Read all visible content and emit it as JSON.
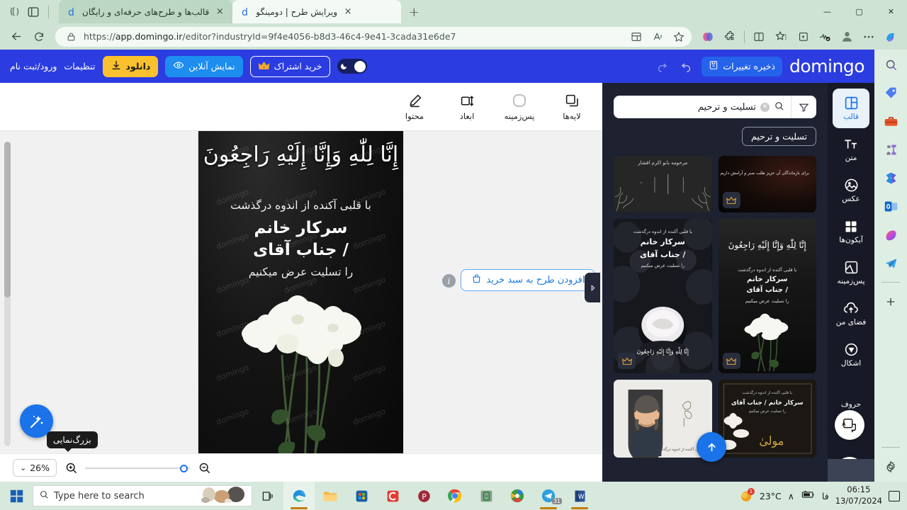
{
  "browser": {
    "tabs": [
      {
        "title": "قالب‌ها و طرح‌های حرفه‌ای و رایگان",
        "favicon": "domingo-d-icon",
        "active": false,
        "close": "×"
      },
      {
        "title": "ویرایش طرح | دومینگو",
        "favicon": "domingo-d-icon",
        "active": true,
        "close": "×"
      }
    ],
    "new_tab_label": "+",
    "window_controls": {
      "minimize": "—",
      "maximize": "▢",
      "close": "✕"
    },
    "url_scheme": "https://",
    "url_host": "app.domingo.ir",
    "url_path": "/editor?industryId=9f4e4056-b8d3-46c4-9e41-3cada31e6de7",
    "nav": {
      "back": "←",
      "reload": "⟳",
      "lock": "lock-icon"
    },
    "toolbar_icons": [
      "split-screen-icon",
      "read-aloud-icon",
      "favorite-star-icon",
      "copilot-icon",
      "extensions-icon",
      "browser-essentials-icon",
      "favorites-list-icon",
      "collections-icon",
      "performance-icon",
      "profile-icon",
      "settings-more-icon",
      "copilot-sidebar-icon"
    ],
    "sidebar_icons": [
      "search-icon",
      "shopping-tag-icon",
      "tools-icon",
      "games-icon",
      "microsoft-365-icon",
      "outlook-icon",
      "designer-icon",
      "telegram-icon",
      "add-icon",
      "settings-gear-icon"
    ]
  },
  "app_header": {
    "logo": "domingo",
    "save_label": "ذخیره تغییرات",
    "save_icon": "save-disk-icon",
    "undo_icon": "undo-arrow-icon",
    "redo_icon": "redo-arrow-icon",
    "theme_toggle": "dark-mode-toggle",
    "subscribe_label": "خرید اشتراک",
    "subscribe_icon": "crown-icon",
    "preview_label": "نمایش آنلاین",
    "preview_icon": "eye-icon",
    "download_label": "دانلود",
    "download_icon": "download-arrow-icon",
    "settings_label": "تنظیمات",
    "login_label": "ورود/ثبت نام"
  },
  "tools": [
    {
      "label": "لایه‌ها",
      "icon": "layers-icon"
    },
    {
      "label": "پس‌زمینه",
      "icon": "rounded-square-icon"
    },
    {
      "label": "ابعاد",
      "icon": "dimensions-icon"
    },
    {
      "label": "محتوا",
      "icon": "edit-pencil-icon"
    }
  ],
  "canvas": {
    "cart_button_label": "افزودن طرح به سبد خرید",
    "cart_icon": "shopping-bag-icon",
    "info_icon": "i",
    "magic_icon": "magic-wand-icon",
    "tooltip": "بزرگ‌نمایی",
    "collapse_icon": "chevron-right-icon",
    "design": {
      "calligraphy": "إِنَّا لِلّٰهِ وَإِنَّا إِلَيْهِ رَاجِعُونَ",
      "line1": "با قلبی آکنده از اندوه درگذشت",
      "line2": "سرکار خانم",
      "line3": "/ جناب آقای",
      "line4": "را تسلیت عرض میکنیم",
      "watermark": "domingo"
    }
  },
  "zoombar": {
    "zoom_value": "26%",
    "chevron": "⌄",
    "zoom_in_icon": "zoom-in-icon",
    "zoom_out_icon": "zoom-out-icon"
  },
  "panel": {
    "filter_icon": "filter-funnel-icon",
    "search_icon": "search-icon",
    "search_value": "تسلیت و ترحیم",
    "clear_icon": "clear-x-icon",
    "chip_label": "تسلیت و ترحیم",
    "crown_icon": "crown-icon",
    "scroll_top_icon": "arrow-up-icon",
    "thumbnails": [
      {
        "name": "thumb-condolence-1",
        "text": "برای بازماندگان آن عزیز طلب صبر و آرامش داریم",
        "premium": true
      },
      {
        "name": "thumb-memorial-2",
        "text": "مرحومه بانو اکرم افشار",
        "premium": false
      },
      {
        "name": "thumb-condolence-flowers",
        "text": "سرکار خانم / جناب آقای",
        "premium": true
      },
      {
        "name": "thumb-condolence-roses",
        "text": "سرکار خانم / جناب آقای",
        "premium": true
      },
      {
        "name": "thumb-condolence-gold",
        "text": "سرکار خانم / جناب آقای",
        "premium": false
      },
      {
        "name": "thumb-portrait-memorial",
        "text": "با قلبی آکنده از اندوه درگذشت",
        "premium": false
      }
    ]
  },
  "rail": [
    {
      "label": "قالب",
      "icon": "template-grid-icon",
      "active": true
    },
    {
      "label": "متن",
      "icon": "text-tt-icon",
      "active": false
    },
    {
      "label": "عکس",
      "icon": "image-icon",
      "active": false
    },
    {
      "label": "آیکون‌ها",
      "icon": "icons-grid-icon",
      "active": false
    },
    {
      "label": "پس‌زمینه",
      "icon": "background-icon",
      "active": false
    },
    {
      "label": "فضای من",
      "icon": "cloud-upload-icon",
      "active": false
    },
    {
      "label": "اشکال",
      "icon": "shapes-icon",
      "active": false
    },
    {
      "label": "حروف",
      "icon": "fonts-icon",
      "active": false
    }
  ],
  "taskbar": {
    "start_icon": "windows-start-icon",
    "search_placeholder": "Type here to search",
    "search_icon": "search-icon",
    "task_view_icon": "task-view-icon",
    "apps": [
      "edge-icon",
      "file-explorer-icon",
      "microsoft-store-icon",
      "camtasia-icon",
      "potplayer-icon",
      "chrome-icon",
      "app-green-icon",
      "idm-icon",
      "telegram-icon",
      "word-icon"
    ],
    "telegram_badge": "31",
    "weather_temp": "23°C",
    "weather_icon": "weather-sun-icon",
    "weather_badge": "1",
    "tray_chevron": "∧",
    "tray_icons": [
      "battery-icon",
      "language-fa-icon"
    ],
    "language": "فا",
    "time": "06:15",
    "date": "13/07/2024",
    "notification_icon": "notification-icon"
  }
}
